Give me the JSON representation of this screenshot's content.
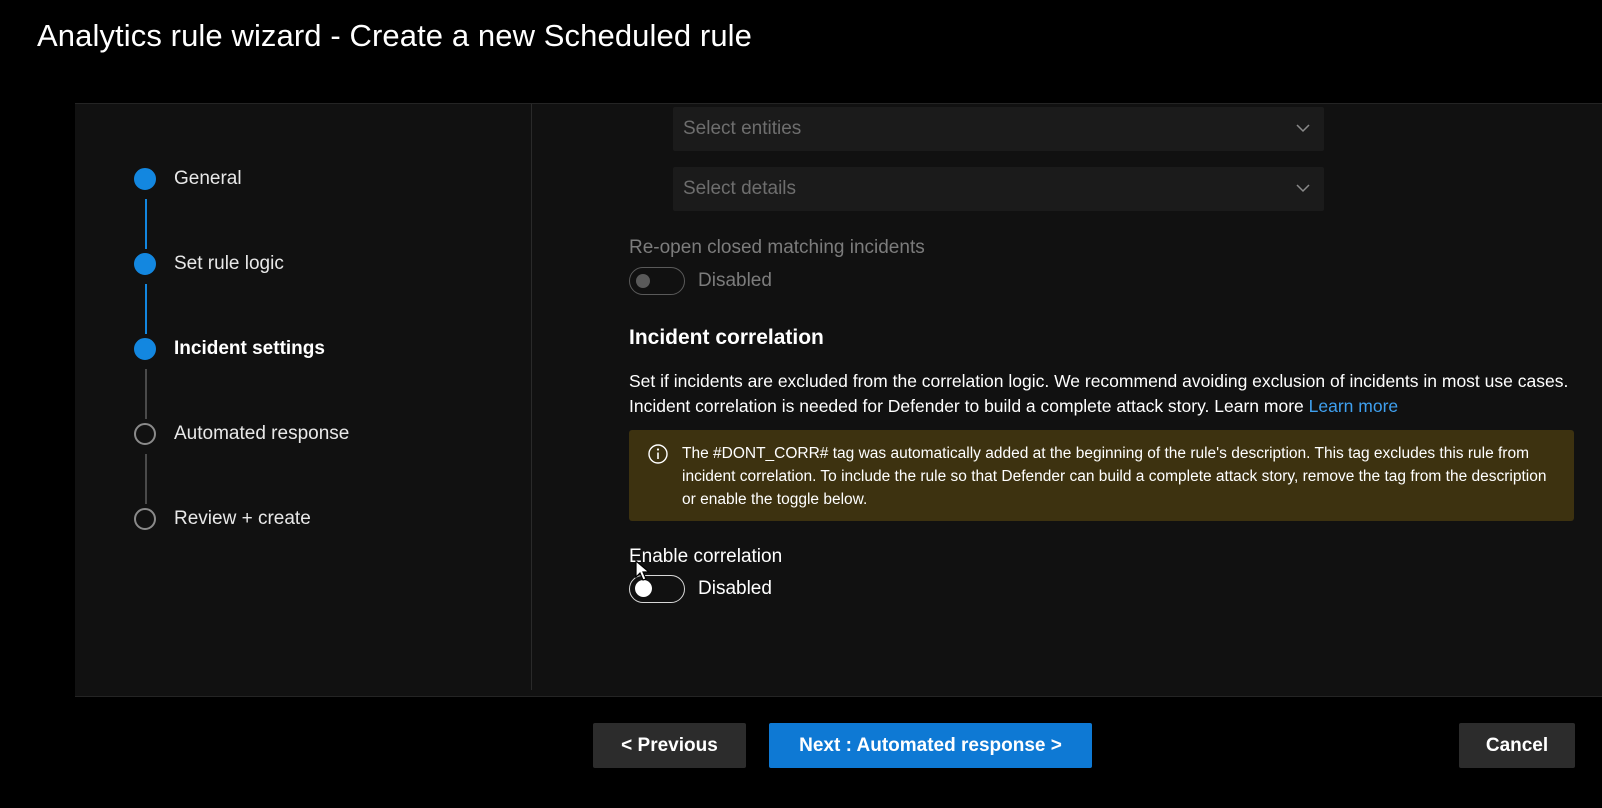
{
  "window": {
    "title": "Analytics rule wizard - Create a new Scheduled rule"
  },
  "wizard": {
    "steps": [
      {
        "label": "General",
        "state": "complete"
      },
      {
        "label": "Set rule logic",
        "state": "complete"
      },
      {
        "label": "Incident settings",
        "state": "current"
      },
      {
        "label": "Automated response",
        "state": "pending"
      },
      {
        "label": "Review + create",
        "state": "pending"
      }
    ]
  },
  "form": {
    "entities_select": {
      "placeholder": "Select entities",
      "icon": "chevron-down-icon"
    },
    "details_select": {
      "placeholder": "Select details",
      "icon": "chevron-down-icon"
    },
    "reopen": {
      "label": "Re-open closed matching incidents",
      "toggle_state": "Disabled"
    },
    "correlation": {
      "title": "Incident correlation",
      "description": "Set if incidents are excluded from the correlation logic. We recommend avoiding exclusion of incidents in most use cases. Incident correlation is needed for Defender to build a complete attack story. Learn more",
      "link": "Learn more",
      "warning": {
        "icon": "info-icon",
        "text": "The #DONT_CORR# tag was automatically added at the beginning of the rule's description. This tag excludes this rule from incident correlation. To include the rule so that Defender can build a complete attack story, remove the tag from the description or enable the toggle below."
      },
      "enable_label": "Enable correlation",
      "enable_toggle_state": "Disabled"
    }
  },
  "footer": {
    "previous_label": "< Previous",
    "next_label": "Next : Automated response >",
    "cancel_label": "Cancel"
  },
  "colors": {
    "accent": "#0e79d4",
    "step_complete": "#1387e0",
    "warning_bg": "#3d3210",
    "link": "#3fa0ef"
  }
}
